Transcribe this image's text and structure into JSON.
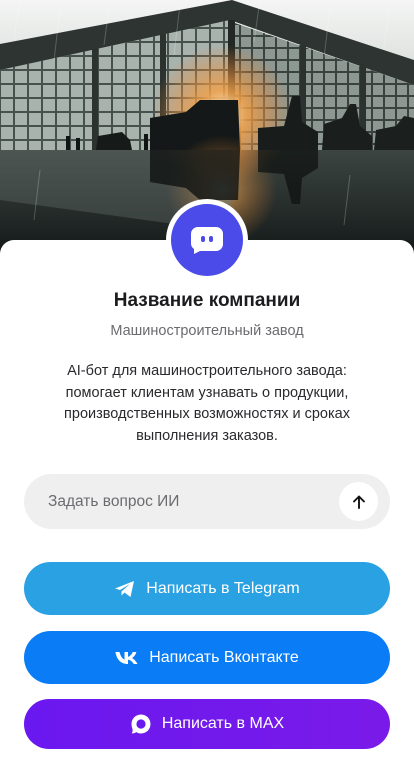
{
  "hero": {
    "image_description_icon": "factory-hero-image"
  },
  "company": {
    "name": "Название компании",
    "subtitle": "Машиностроительный завод",
    "description": "AI-бот для машиностроительного завода: помогает клиентам узнавать о продукции, производственных возможностях и сроках выполнения заказов."
  },
  "ask": {
    "placeholder": "Задать вопрос ИИ",
    "send_icon": "arrow-up-icon"
  },
  "actions": {
    "telegram_label": "Написать в Telegram",
    "vk_label": "Написать Вконтакте",
    "max_label": "Написать в MAX"
  },
  "colors": {
    "avatar": "#4a4be8",
    "telegram": "#2aa1e3",
    "vk": "#0a7df6",
    "max": "#6a18f0",
    "ask_bg": "#efefef"
  }
}
